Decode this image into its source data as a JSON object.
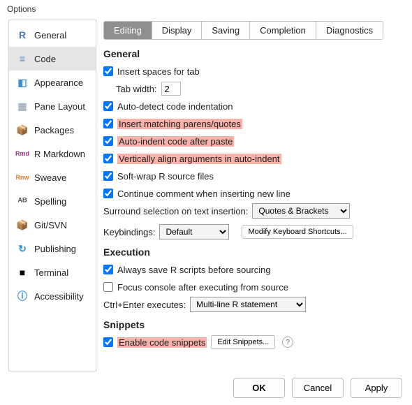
{
  "window_title": "Options",
  "sidebar": {
    "items": [
      {
        "label": "General",
        "icon_text": "R",
        "icon_color": "#4e7cc0"
      },
      {
        "label": "Code",
        "icon_text": "≡",
        "icon_color": "#4a7abf",
        "selected": true
      },
      {
        "label": "Appearance",
        "icon_text": "◧",
        "icon_color": "#3e8fcf"
      },
      {
        "label": "Pane Layout",
        "icon_text": "▦",
        "icon_color": "#a8b4c4"
      },
      {
        "label": "Packages",
        "icon_text": "📦",
        "icon_color": "#c18a3b"
      },
      {
        "label": "R Markdown",
        "icon_text": "Rmd",
        "icon_color": "#a2308f"
      },
      {
        "label": "Sweave",
        "icon_text": "Rnw",
        "icon_color": "#e07a1f"
      },
      {
        "label": "Spelling",
        "icon_text": "ᴬᴮ",
        "icon_color": "#555"
      },
      {
        "label": "Git/SVN",
        "icon_text": "📦",
        "icon_color": "#c18a3b"
      },
      {
        "label": "Publishing",
        "icon_text": "↻",
        "icon_color": "#1e8fd6"
      },
      {
        "label": "Terminal",
        "icon_text": "■",
        "icon_color": "#000"
      },
      {
        "label": "Accessibility",
        "icon_text": "ⓘ",
        "icon_color": "#1e8fd6"
      }
    ]
  },
  "tabs": [
    {
      "label": "Editing",
      "active": true
    },
    {
      "label": "Display"
    },
    {
      "label": "Saving"
    },
    {
      "label": "Completion"
    },
    {
      "label": "Diagnostics"
    }
  ],
  "sections": {
    "general_heading": "General",
    "execution_heading": "Execution",
    "snippets_heading": "Snippets"
  },
  "general": {
    "insert_spaces": {
      "label": "Insert spaces for tab",
      "checked": true
    },
    "tab_width_label": "Tab width:",
    "tab_width_value": "2",
    "auto_detect": {
      "label": "Auto-detect code indentation",
      "checked": true
    },
    "insert_matching": {
      "label": "Insert matching parens/quotes",
      "checked": true,
      "highlight": true
    },
    "auto_indent_paste": {
      "label": "Auto-indent code after paste",
      "checked": true,
      "highlight": true
    },
    "vert_align": {
      "label": "Vertically align arguments in auto-indent",
      "checked": true,
      "highlight": true
    },
    "soft_wrap": {
      "label": "Soft-wrap R source files",
      "checked": true
    },
    "continue_comment": {
      "label": "Continue comment when inserting new line",
      "checked": true
    },
    "surround_label": "Surround selection on text insertion:",
    "surround_value": "Quotes & Brackets",
    "keybindings_label": "Keybindings:",
    "keybindings_value": "Default",
    "modify_shortcuts": "Modify Keyboard Shortcuts..."
  },
  "execution": {
    "always_save": {
      "label": "Always save R scripts before sourcing",
      "checked": true
    },
    "focus_console": {
      "label": "Focus console after executing from source",
      "checked": false
    },
    "ctrl_enter_label": "Ctrl+Enter executes:",
    "ctrl_enter_value": "Multi-line R statement"
  },
  "snippets": {
    "enable": {
      "label": "Enable code snippets",
      "checked": true,
      "highlight": true
    },
    "edit_button": "Edit Snippets..."
  },
  "footer": {
    "ok": "OK",
    "cancel": "Cancel",
    "apply": "Apply"
  }
}
